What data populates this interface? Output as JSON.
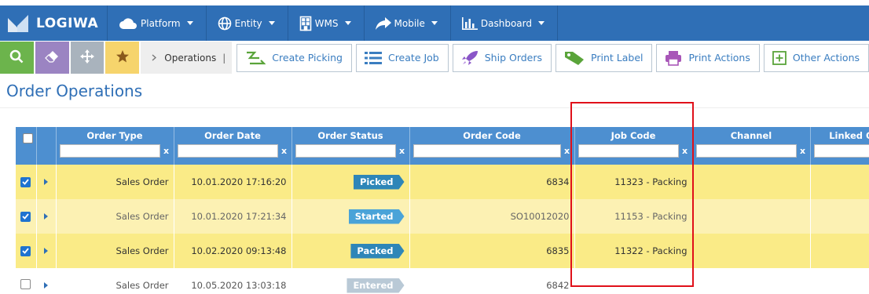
{
  "app": {
    "logo_text": "LOGIWA"
  },
  "nav": [
    {
      "label": "Platform",
      "icon": "cloud-icon"
    },
    {
      "label": "Entity",
      "icon": "globe-icon"
    },
    {
      "label": "WMS",
      "icon": "building-icon"
    },
    {
      "label": "Mobile",
      "icon": "share-icon"
    },
    {
      "label": "Dashboard",
      "icon": "bar-chart-icon"
    }
  ],
  "toolbar": {
    "breadcrumb": "Operations",
    "breadcrumb_sep": "|",
    "actions": [
      {
        "label": "Create Picking",
        "icon": "picking-icon"
      },
      {
        "label": "Create Job",
        "icon": "list-icon"
      },
      {
        "label": "Ship Orders",
        "icon": "rocket-icon"
      },
      {
        "label": "Print Label",
        "icon": "tag-icon"
      },
      {
        "label": "Print Actions",
        "icon": "printer-icon"
      },
      {
        "label": "Other Actions",
        "icon": "plus-square-icon"
      }
    ]
  },
  "page": {
    "title": "Order Operations"
  },
  "grid": {
    "columns": [
      "Order Type",
      "Order Date",
      "Order Status",
      "Order Code",
      "Job Code",
      "Channel",
      "Linked O"
    ],
    "filter_clear": "x",
    "rows": [
      {
        "checked": true,
        "order_type": "Sales Order",
        "order_date": "10.01.2020 17:16:20",
        "status": "Picked",
        "status_color": "#2e86b8",
        "order_code": "6834",
        "job_code": "11323 - Packing",
        "channel": "",
        "linked": ""
      },
      {
        "checked": true,
        "order_type": "Sales Order",
        "order_date": "10.01.2020 17:21:34",
        "status": "Started",
        "status_color": "#4aa3d8",
        "order_code": "SO10012020",
        "job_code": "11153 - Packing",
        "channel": "",
        "linked": ""
      },
      {
        "checked": true,
        "order_type": "Sales Order",
        "order_date": "10.02.2020 09:13:48",
        "status": "Packed",
        "status_color": "#2e86b8",
        "order_code": "6835",
        "job_code": "11322 - Packing",
        "channel": "",
        "linked": ""
      },
      {
        "checked": false,
        "order_type": "Sales Order",
        "order_date": "10.05.2020 13:03:18",
        "status": "Entered",
        "status_color": "#b9c9d6",
        "order_code": "6842",
        "job_code": "",
        "channel": "",
        "linked": ""
      }
    ]
  },
  "colors": {
    "brand": "#2f6fb6",
    "header": "#4d8fd0",
    "row_selected": "#faeb87",
    "highlight": "#e0101a"
  }
}
